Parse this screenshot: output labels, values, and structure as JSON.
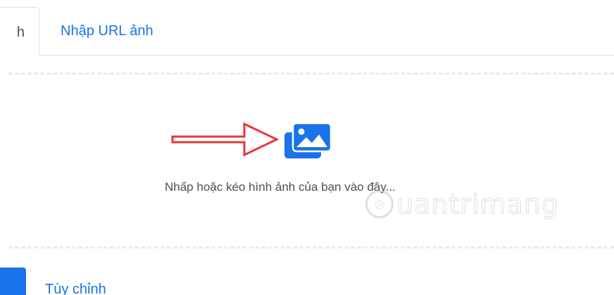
{
  "tabs": {
    "active_partial_label": "h",
    "url_label": "Nhập URL ảnh"
  },
  "dropzone": {
    "icon": "images-icon",
    "text": "Nhấp hoặc kéo hình ảnh của bạn vào đây..."
  },
  "annotation": {
    "arrow": "red-arrow-pointing-right"
  },
  "watermark": {
    "text": "uantrimang",
    "icon": "watermark-logo-icon"
  },
  "option": {
    "label": "Tùy chỉnh"
  },
  "colors": {
    "accent": "#1a73e8",
    "text": "#495057",
    "arrow": "#e53935",
    "border": "#dee2e6"
  }
}
